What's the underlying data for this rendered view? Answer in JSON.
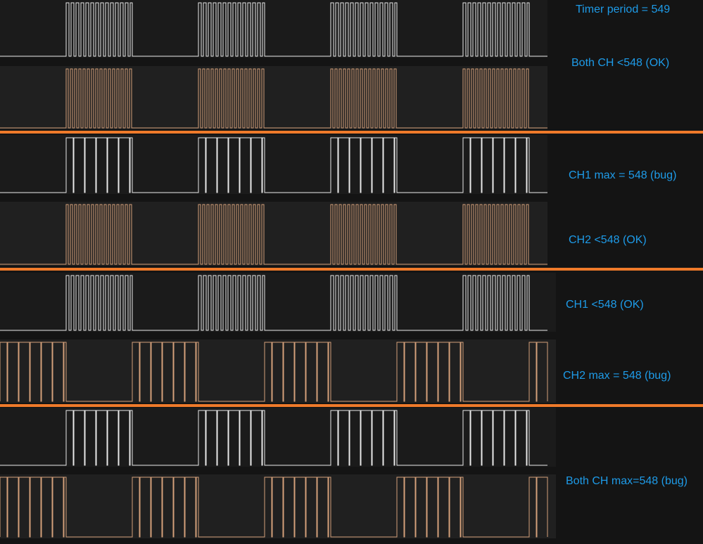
{
  "colors": {
    "background": "#141414",
    "trace_bg_a": "#1b1b1b",
    "trace_bg_b": "#202020",
    "ch1_trace": "#e8e8e8",
    "ch2_trace": "#d4a07a",
    "divider": "#ef7a2a",
    "label": "#1e9be8"
  },
  "labels": {
    "timer_period": "Timer period = 549",
    "g1": "Both CH <548 (OK)",
    "g2_ch1": "CH1 max = 548 (bug)",
    "g2_ch2": "CH2 <548 (OK)",
    "g3_ch1": "CH1 <548 (OK)",
    "g3_ch2": "CH2 max = 548 (bug)",
    "g4": "Both CH max=548 (bug)"
  },
  "groups": [
    {
      "name": "both-ch-ok",
      "ch1_mode": "ok",
      "ch2_mode": "ok",
      "ch1_phase": 0.0,
      "ch2_phase": 0.0
    },
    {
      "name": "ch1-bug-ch2-ok",
      "ch1_mode": "bug",
      "ch2_mode": "ok",
      "ch1_phase": 0.0,
      "ch2_phase": 0.0
    },
    {
      "name": "ch1-ok-ch2-bug",
      "ch1_mode": "ok",
      "ch2_mode": "bug",
      "ch1_phase": 0.0,
      "ch2_phase": 0.5
    },
    {
      "name": "both-ch-bug",
      "ch1_mode": "bug",
      "ch2_mode": "bug",
      "ch1_phase": 0.0,
      "ch2_phase": 0.5
    }
  ]
}
